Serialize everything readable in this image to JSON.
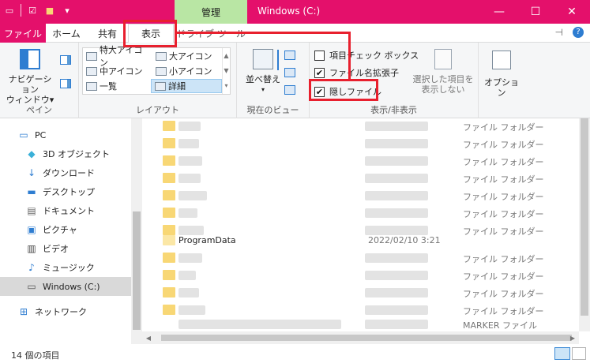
{
  "titlebar": {
    "context_tab": "管理",
    "window_title": "Windows (C:)",
    "minimize": "—",
    "maximize": "☐",
    "close": "✕"
  },
  "tabs": {
    "file": "ファイル",
    "home": "ホーム",
    "share": "共有",
    "view": "表示",
    "drive_tools": "ドライブ ツール"
  },
  "ribbon": {
    "pane_group": {
      "nav_pane_line1": "ナビゲーション",
      "nav_pane_line2": "ウィンドウ▾",
      "label": "ペイン"
    },
    "layout_group": {
      "items": [
        "特大アイコン",
        "大アイコン",
        "中アイコン",
        "小アイコン",
        "一覧",
        "詳細"
      ],
      "selected": "詳細",
      "label": "レイアウト"
    },
    "current_view_group": {
      "sort_line1": "並べ替え",
      "label": "現在のビュー"
    },
    "show_hide_group": {
      "item_checkboxes": "項目チェック ボックス",
      "file_extensions": "ファイル名拡張子",
      "hidden_items": "隠しファイル",
      "item_checkboxes_checked": false,
      "file_extensions_checked": true,
      "hidden_items_checked": true,
      "hide_selected_line1": "選択した項目を",
      "hide_selected_line2": "表示しない",
      "label": "表示/非表示"
    },
    "options": "オプション"
  },
  "nav": {
    "items": [
      "PC",
      "3D オブジェクト",
      "ダウンロード",
      "デスクトップ",
      "ドキュメント",
      "ピクチャ",
      "ビデオ",
      "ミュージック",
      "Windows (C:)",
      "ネットワーク"
    ],
    "selected": "Windows (C:)"
  },
  "files": {
    "folder_type": "ファイル フォルダー",
    "programdata_name": "ProgramData",
    "programdata_date": "2022/02/10 3:21",
    "marker_type": "MARKER ファイル"
  },
  "status": {
    "item_count": "14 個の項目"
  },
  "colors": {
    "titlebar": "#e4106b",
    "context_tab": "#b9e6a4",
    "highlight": "#e8202e",
    "selection": "#cce4f7"
  }
}
